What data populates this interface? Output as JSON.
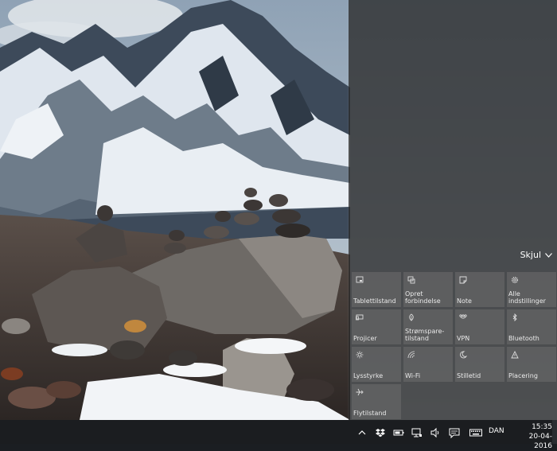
{
  "action_center": {
    "collapse_label": "Skjul",
    "tiles": [
      {
        "label": "Tablettilstand",
        "icon": "tablet-mode-icon"
      },
      {
        "label": "Opret forbindelse",
        "icon": "connect-icon"
      },
      {
        "label": "Note",
        "icon": "note-icon"
      },
      {
        "label": "Alle indstillinger",
        "icon": "settings-gear-icon"
      },
      {
        "label": "Projicer",
        "icon": "project-icon"
      },
      {
        "label": "Strømspare-tilstand",
        "icon": "battery-saver-icon"
      },
      {
        "label": "VPN",
        "icon": "vpn-icon"
      },
      {
        "label": "Bluetooth",
        "icon": "bluetooth-icon"
      },
      {
        "label": "Lysstyrke",
        "icon": "brightness-icon"
      },
      {
        "label": "Wi-Fi",
        "icon": "wifi-icon"
      },
      {
        "label": "Stilletid",
        "icon": "quiet-hours-moon-icon"
      },
      {
        "label": "Placering",
        "icon": "location-icon"
      },
      {
        "label": "Flytilstand",
        "icon": "airplane-icon"
      }
    ]
  },
  "taskbar": {
    "language": "DAN",
    "time": "15:35",
    "date": "20-04-2016",
    "tray_icons": [
      "chevron-up-icon",
      "dropbox-icon",
      "battery-icon",
      "network-icon",
      "volume-icon",
      "action-center-icon",
      "keyboard-icon"
    ]
  }
}
